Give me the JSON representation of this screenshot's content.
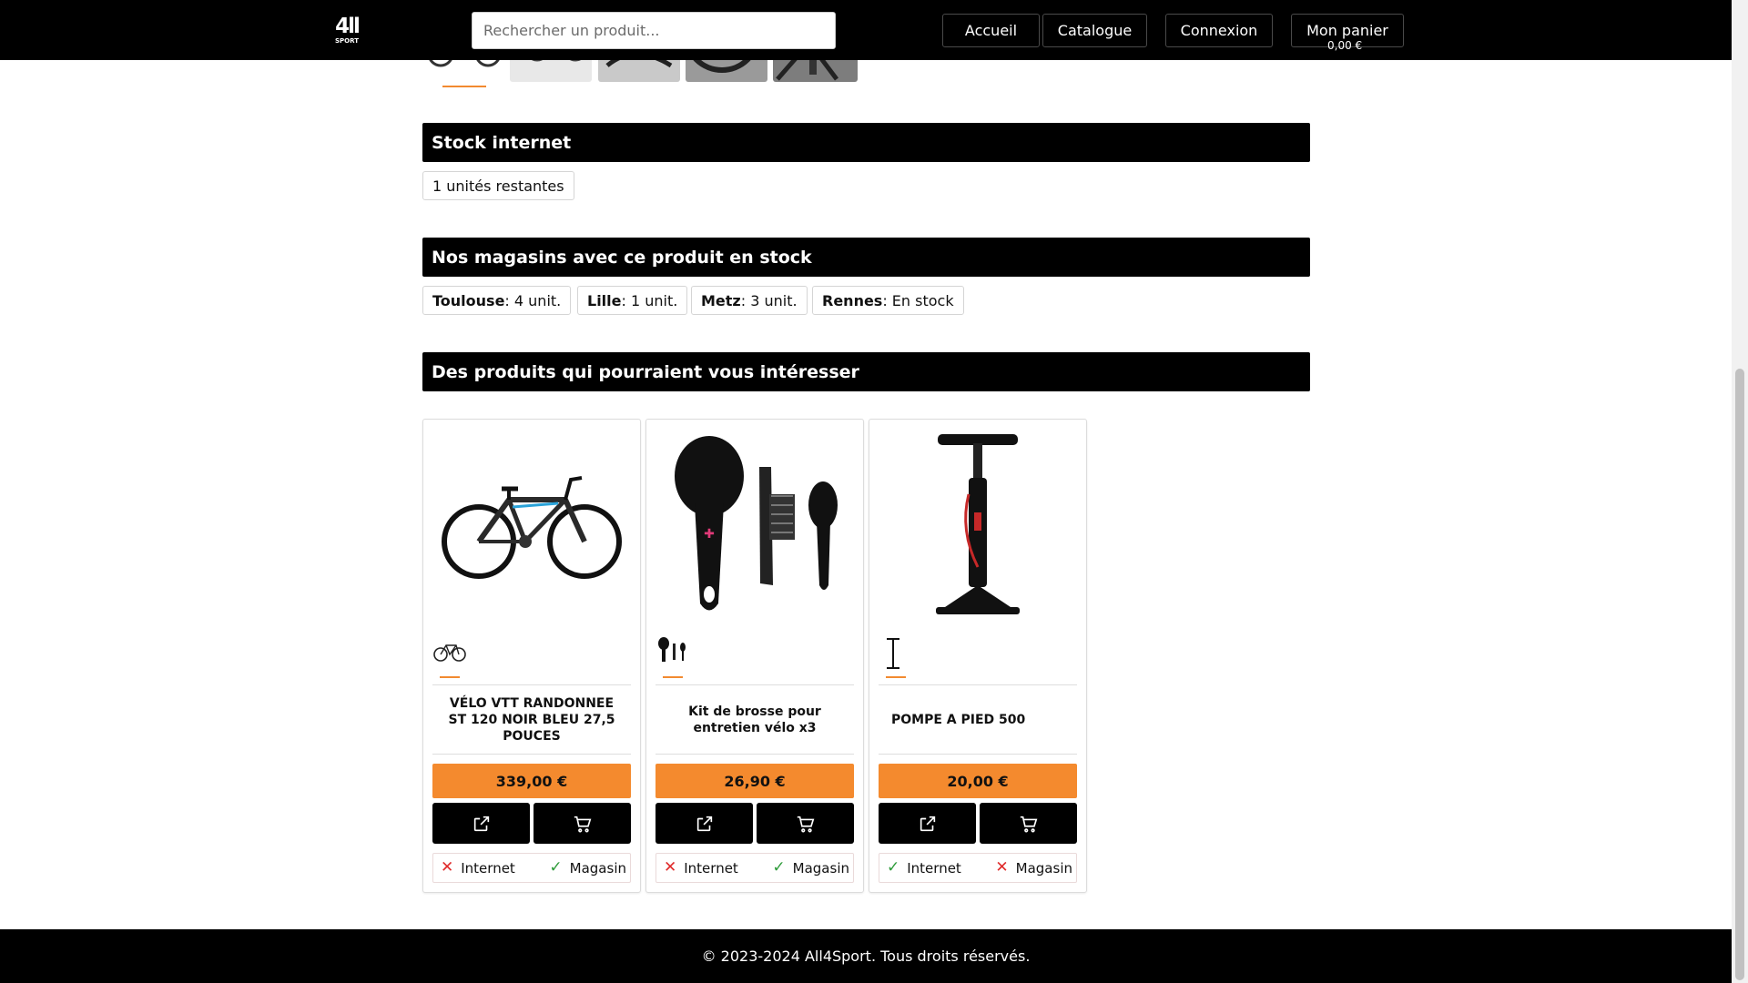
{
  "header": {
    "logo_top": "4ll",
    "logo_bottom": "SPORT",
    "search_placeholder": "Rechercher un produit...",
    "nav": [
      "Accueil",
      "Catalogue",
      "Connexion",
      "Mon panier"
    ],
    "cart_total": "0,00 €"
  },
  "stock_internet": {
    "title": "Stock internet",
    "remaining": "1 unités restantes"
  },
  "stores": {
    "title": "Nos magasins avec ce produit en stock",
    "items": [
      {
        "city": "Toulouse",
        "value": " : 4 unit."
      },
      {
        "city": "Lille",
        "value": " : 1 unit."
      },
      {
        "city": "Metz",
        "value": " : 3 unit."
      },
      {
        "city": "Rennes",
        "value": " : En stock"
      }
    ]
  },
  "related": {
    "title": "Des produits qui pourraient vous intéresser",
    "products": [
      {
        "name": "VÉLO VTT RANDONNEE ST 120 NOIR BLEU 27,5 POUCES",
        "price": "339,00 €",
        "internet_label": "Internet",
        "store_label": "Magasin",
        "internet": false,
        "store": true,
        "image": "bike-icon"
      },
      {
        "name": "Kit de brosse pour entretien vélo x3",
        "price": "26,90 €",
        "internet_label": "Internet",
        "store_label": "Magasin",
        "internet": false,
        "store": true,
        "image": "brush-kit-icon"
      },
      {
        "name": "POMPE A PIED 500",
        "price": "20,00 €",
        "internet_label": "Internet",
        "store_label": "Magasin",
        "internet": true,
        "store": false,
        "image": "floor-pump-icon"
      }
    ]
  },
  "footer": {
    "copyright": "© 2023-2024 All4Sport. Tous droits réservés."
  },
  "colors": {
    "accent": "#f48a2e",
    "bar": "#000000",
    "ok": "#2f9c3b",
    "ko": "#e02a2a"
  }
}
